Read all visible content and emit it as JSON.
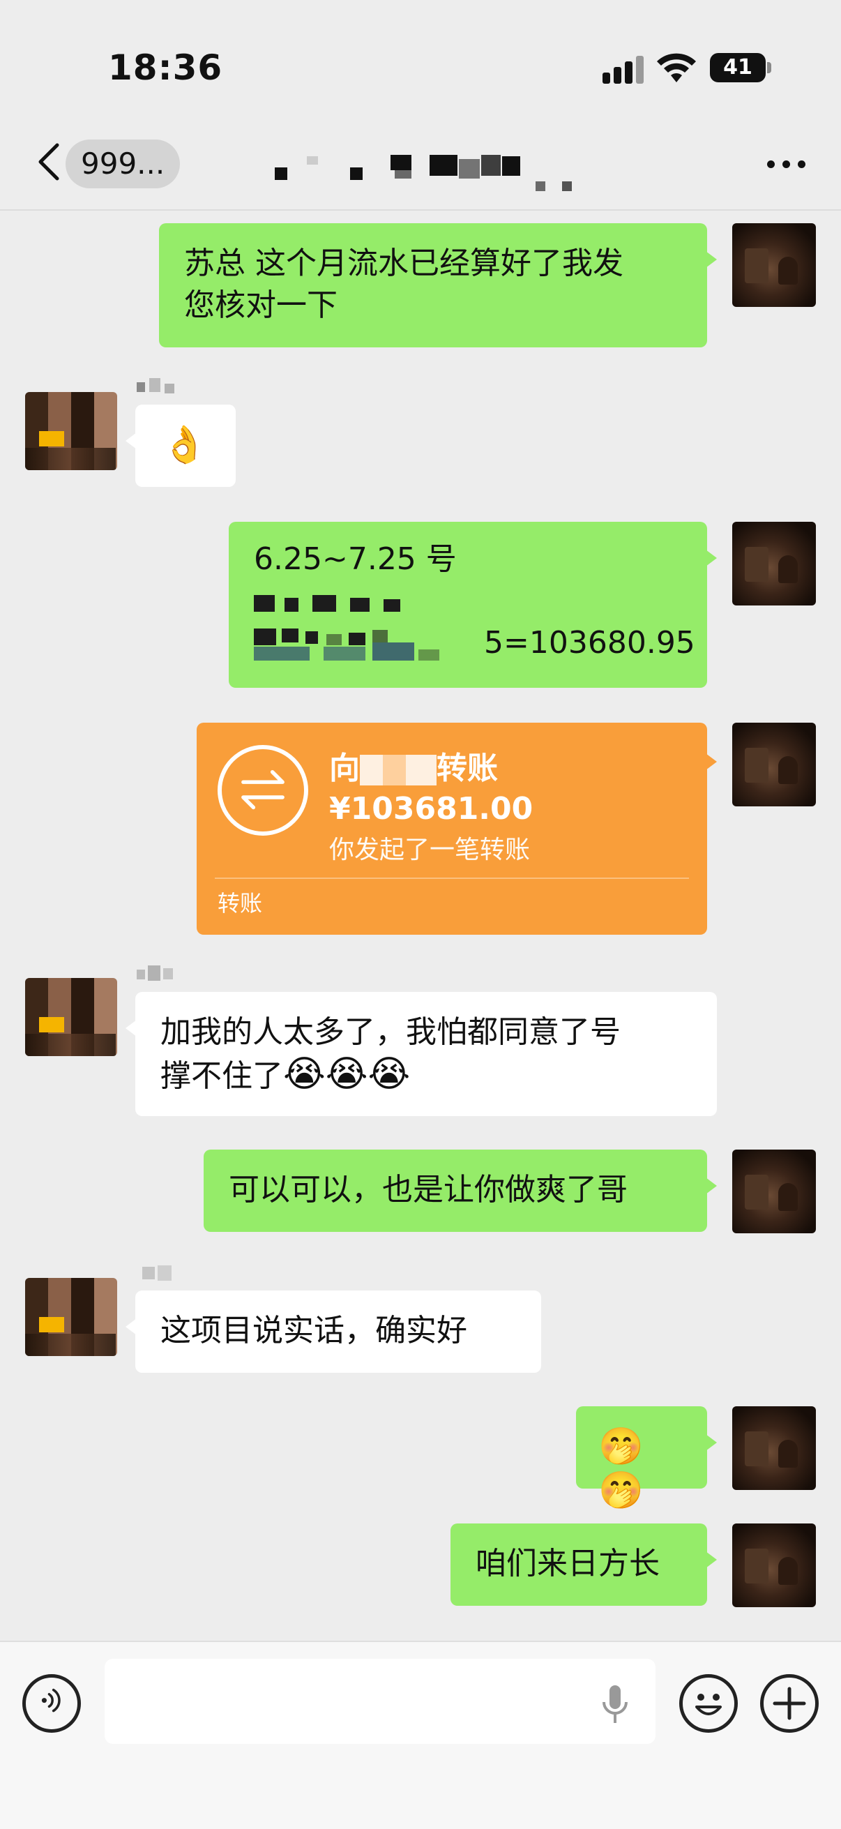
{
  "status_bar": {
    "time": "18:36",
    "battery": "41"
  },
  "nav": {
    "back_label": "999..."
  },
  "messages": [
    {
      "side": "self",
      "text_line1": "苏总 这个月流水已经算好了我发",
      "text_line2": "您核对一下"
    },
    {
      "side": "peer",
      "text": "👌"
    },
    {
      "side": "self",
      "line1": "6.25~7.25 号",
      "line2_suffix": "5=103680.95"
    },
    {
      "side": "self",
      "type": "transfer",
      "title_prefix": "向",
      "title_suffix": "转账",
      "amount": "¥103681.00",
      "description": "你发起了一笔转账",
      "label": "转账"
    },
    {
      "side": "peer",
      "text_line1": "加我的人太多了，我怕都同意了号",
      "text_line2": "撑不住了",
      "emojis": "😭😭😭"
    },
    {
      "side": "self",
      "text": "可以可以，也是让你做爽了哥"
    },
    {
      "side": "peer",
      "text": "这项目说实话，确实好"
    },
    {
      "side": "self",
      "text": "🤭🤭"
    },
    {
      "side": "self",
      "text": "咱们来日方长"
    }
  ],
  "input_bar": {
    "placeholder": ""
  },
  "colors": {
    "self_bubble": "#95ec69",
    "peer_bubble": "#ffffff",
    "transfer_card": "#f99e3a",
    "background": "#ededed"
  },
  "icons": [
    "back-chevron-icon",
    "more-icon",
    "voice-icon",
    "mic-icon",
    "emoji-icon",
    "plus-icon",
    "transfer-arrows-icon"
  ]
}
